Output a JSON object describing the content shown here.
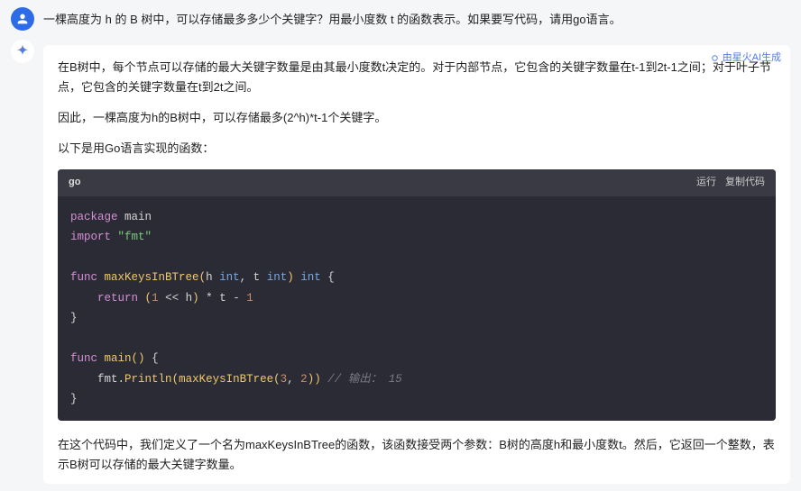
{
  "question": {
    "text": "一棵高度为  h 的 B 树中，可以存储最多多少个关键字？用最小度数 t 的函数表示。如果要写代码，请用go语言。"
  },
  "ai_badge": "由星火AI生成",
  "answer": {
    "p1": "在B树中，每个节点可以存储的最大关键字数量是由其最小度数t决定的。对于内部节点，它包含的关键字数量在t-1到2t-1之间；对于叶子节点，它包含的关键字数量在t到2t之间。",
    "p2": "因此，一棵高度为h的B树中，可以存储最多(2^h)*t-1个关键字。",
    "p3": "以下是用Go语言实现的函数：",
    "p4": "在这个代码中，我们定义了一个名为maxKeysInBTree的函数，该函数接受两个参数：B树的高度h和最小度数t。然后，它返回一个整数，表示B树可以存储的最大关键字数量。"
  },
  "code": {
    "lang": "go",
    "run_label": "运行",
    "copy_label": "复制代码",
    "tokens": {
      "package": "package",
      "main_pkg": "main",
      "import": "import",
      "fmt_str": "\"fmt\"",
      "func": "func",
      "fn_name": "maxKeysInBTree",
      "h_param": "h",
      "t_param": "t",
      "int_type": "int",
      "return": "return",
      "one": "1",
      "shift_op": "<<",
      "star": "*",
      "minus": "-",
      "main_fn": "main",
      "fmt_call": "fmt",
      "println": "Println",
      "arg1": "3",
      "arg2": "2",
      "comment": "// 输出： 15"
    }
  }
}
